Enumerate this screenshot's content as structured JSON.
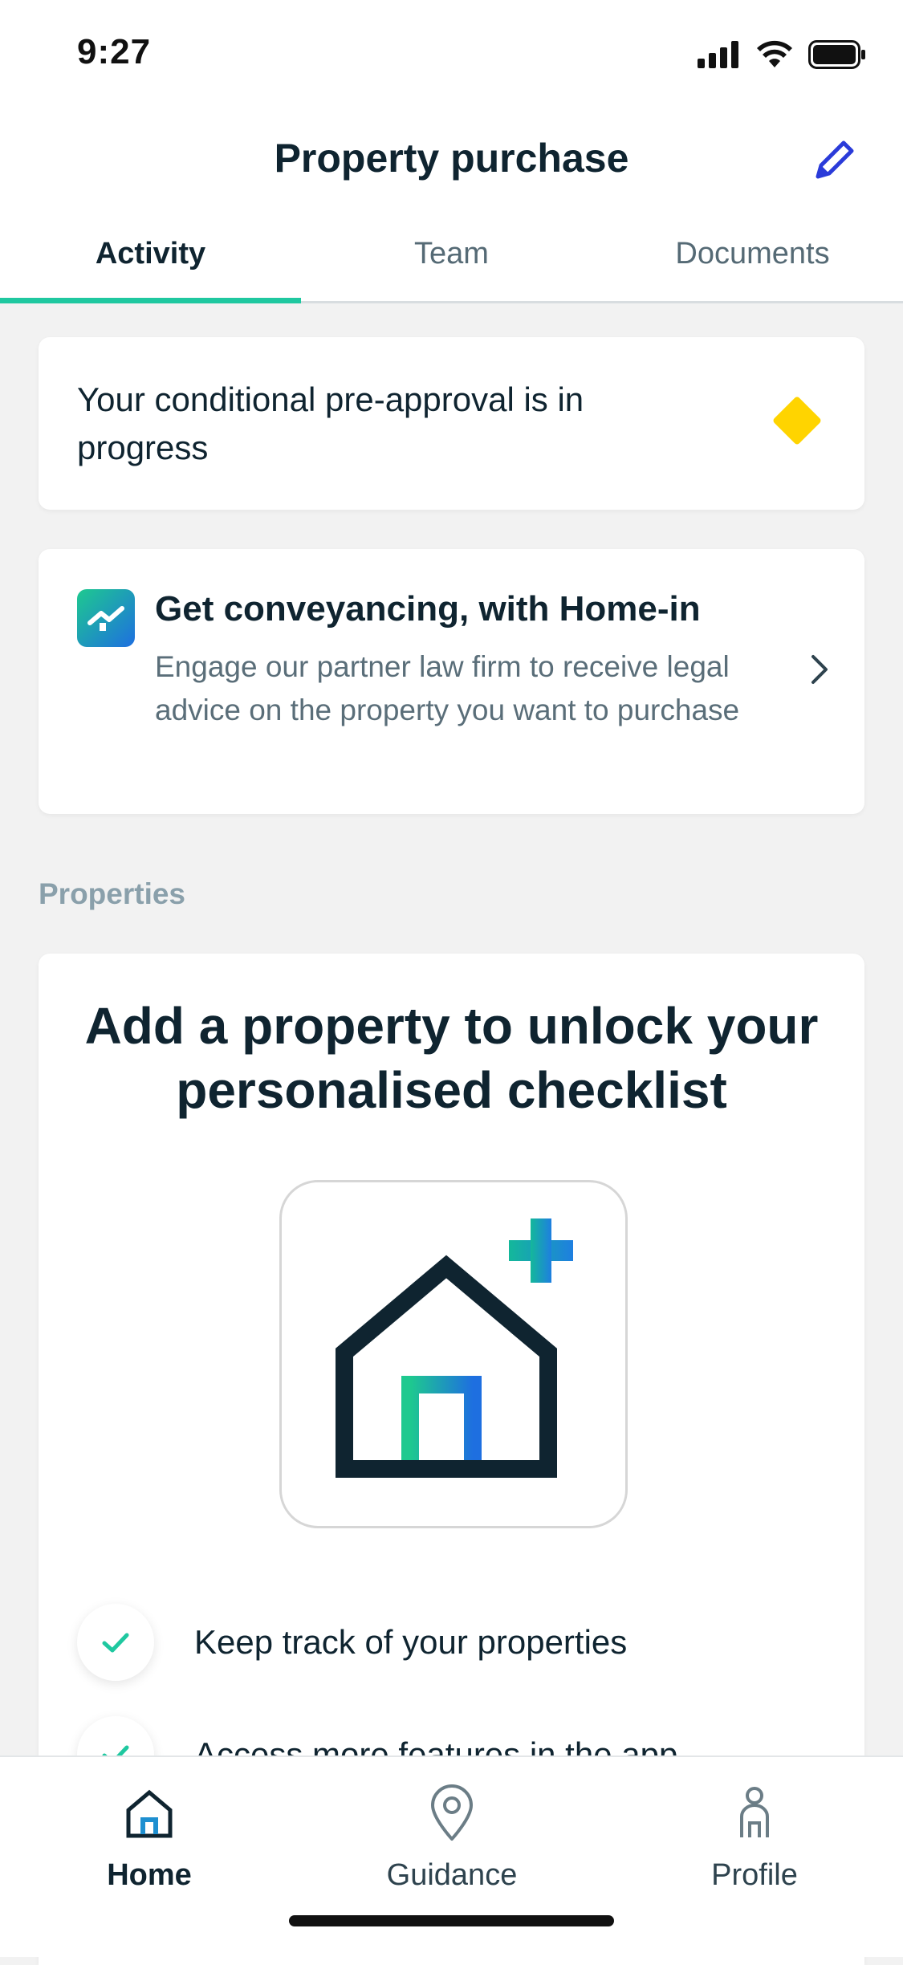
{
  "status_bar": {
    "time": "9:27"
  },
  "header": {
    "title": "Property purchase"
  },
  "tabs": [
    {
      "label": "Activity",
      "active": true
    },
    {
      "label": "Team",
      "active": false
    },
    {
      "label": "Documents",
      "active": false
    }
  ],
  "preapproval_card": {
    "text": "Your conditional pre-approval is in progress"
  },
  "conveyancing_card": {
    "title": "Get conveyancing, with Home-in",
    "description": "Engage our partner law firm to receive legal advice on the property you want to purchase"
  },
  "properties_section": {
    "label": "Properties",
    "title": "Add a property to unlock your personalised checklist",
    "features": [
      "Keep track of your properties",
      "Access more features in the app"
    ]
  },
  "bottom_nav": {
    "items": [
      {
        "label": "Home",
        "icon": "home-icon",
        "active": true
      },
      {
        "label": "Guidance",
        "icon": "location-pin-icon",
        "active": false
      },
      {
        "label": "Profile",
        "icon": "person-icon",
        "active": false
      }
    ]
  },
  "colors": {
    "accent_green": "#1fc8a0",
    "edit_blue": "#2a3bd9",
    "text_dark": "#0f2430",
    "diamond_yellow": "#ffd400"
  }
}
